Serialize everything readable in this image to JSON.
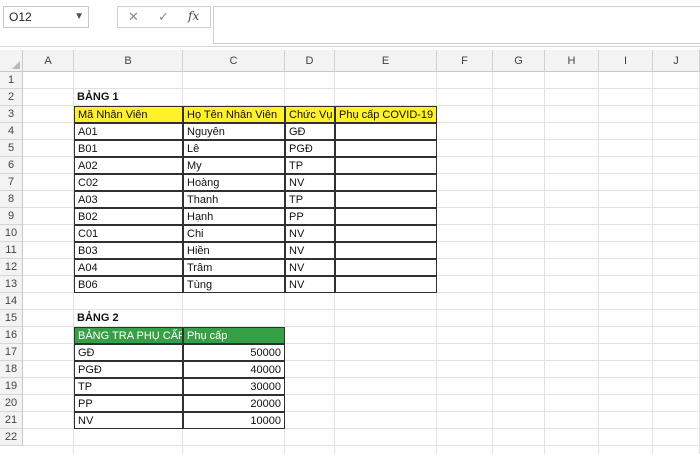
{
  "name_box": "O12",
  "formula_bar": {
    "cancel_icon": "✕",
    "enter_icon": "✓",
    "fx_label": "fx",
    "value": ""
  },
  "columns": [
    "A",
    "B",
    "C",
    "D",
    "E",
    "F",
    "G",
    "H",
    "I",
    "J"
  ],
  "rows": [
    "1",
    "2",
    "3",
    "4",
    "5",
    "6",
    "7",
    "8",
    "9",
    "10",
    "11",
    "12",
    "13",
    "14",
    "15",
    "16",
    "17",
    "18",
    "19",
    "20",
    "21",
    "22"
  ],
  "table1": {
    "title": "BẢNG 1",
    "headers": [
      "Mã Nhân Viên",
      "Họ Tên Nhân Viên",
      "Chức Vụ",
      "Phụ cấp COVID-19"
    ],
    "rows": [
      [
        "A01",
        "Nguyên",
        "GĐ",
        ""
      ],
      [
        "B01",
        "Lê",
        "PGĐ",
        ""
      ],
      [
        "A02",
        "My",
        "TP",
        ""
      ],
      [
        "C02",
        "Hoàng",
        "NV",
        ""
      ],
      [
        "A03",
        "Thanh",
        "TP",
        ""
      ],
      [
        "B02",
        "Hạnh",
        "PP",
        ""
      ],
      [
        "C01",
        "Chi",
        "NV",
        ""
      ],
      [
        "B03",
        "Hiền",
        "NV",
        ""
      ],
      [
        "A04",
        "Trâm",
        "NV",
        ""
      ],
      [
        "B06",
        "Tùng",
        "NV",
        ""
      ]
    ]
  },
  "table2": {
    "title": "BẢNG 2",
    "headers": [
      "BẢNG TRA PHỤ CẤP",
      "Phụ cấp"
    ],
    "rows": [
      [
        "GĐ",
        "50000"
      ],
      [
        "PGĐ",
        "40000"
      ],
      [
        "TP",
        "30000"
      ],
      [
        "PP",
        "20000"
      ],
      [
        "NV",
        "10000"
      ]
    ]
  },
  "colors": {
    "header_yellow": "#fff22a",
    "header_green": "#35a046"
  }
}
